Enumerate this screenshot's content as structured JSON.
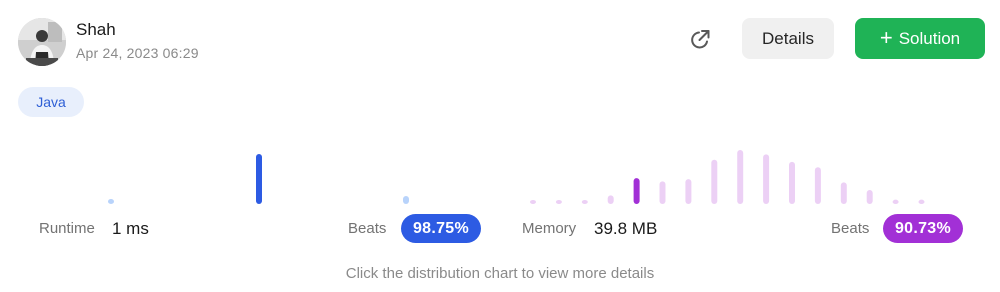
{
  "user": {
    "name": "Shah",
    "timestamp": "Apr 24, 2023 06:29"
  },
  "actions": {
    "details_label": "Details",
    "solution_label": "Solution"
  },
  "language": "Java",
  "runtime": {
    "label": "Runtime",
    "value": "1 ms",
    "beats_label": "Beats",
    "beats_value": "98.75%",
    "accent_color": "#2d5be3",
    "muted_color": "#b8d3fb",
    "distribution": [
      {
        "level": 0.1,
        "highlighted": false
      },
      {
        "level": 1.0,
        "highlighted": true
      },
      {
        "level": 0.16,
        "highlighted": false
      }
    ]
  },
  "memory": {
    "label": "Memory",
    "value": "39.8 MB",
    "beats_label": "Beats",
    "beats_value": "90.73%",
    "accent_color": "#a230d6",
    "muted_color": "#ecd0f5",
    "distribution": [
      {
        "level": 0.06,
        "highlighted": false
      },
      {
        "level": 0.06,
        "highlighted": false
      },
      {
        "level": 0.06,
        "highlighted": false
      },
      {
        "level": 0.16,
        "highlighted": false
      },
      {
        "level": 0.48,
        "highlighted": true
      },
      {
        "level": 0.42,
        "highlighted": false
      },
      {
        "level": 0.46,
        "highlighted": false
      },
      {
        "level": 0.82,
        "highlighted": false
      },
      {
        "level": 1.0,
        "highlighted": false
      },
      {
        "level": 0.92,
        "highlighted": false
      },
      {
        "level": 0.78,
        "highlighted": false
      },
      {
        "level": 0.68,
        "highlighted": false
      },
      {
        "level": 0.4,
        "highlighted": false
      },
      {
        "level": 0.26,
        "highlighted": false
      },
      {
        "level": 0.08,
        "highlighted": false
      },
      {
        "level": 0.08,
        "highlighted": false
      }
    ]
  },
  "hint": "Click the distribution chart to view more details"
}
